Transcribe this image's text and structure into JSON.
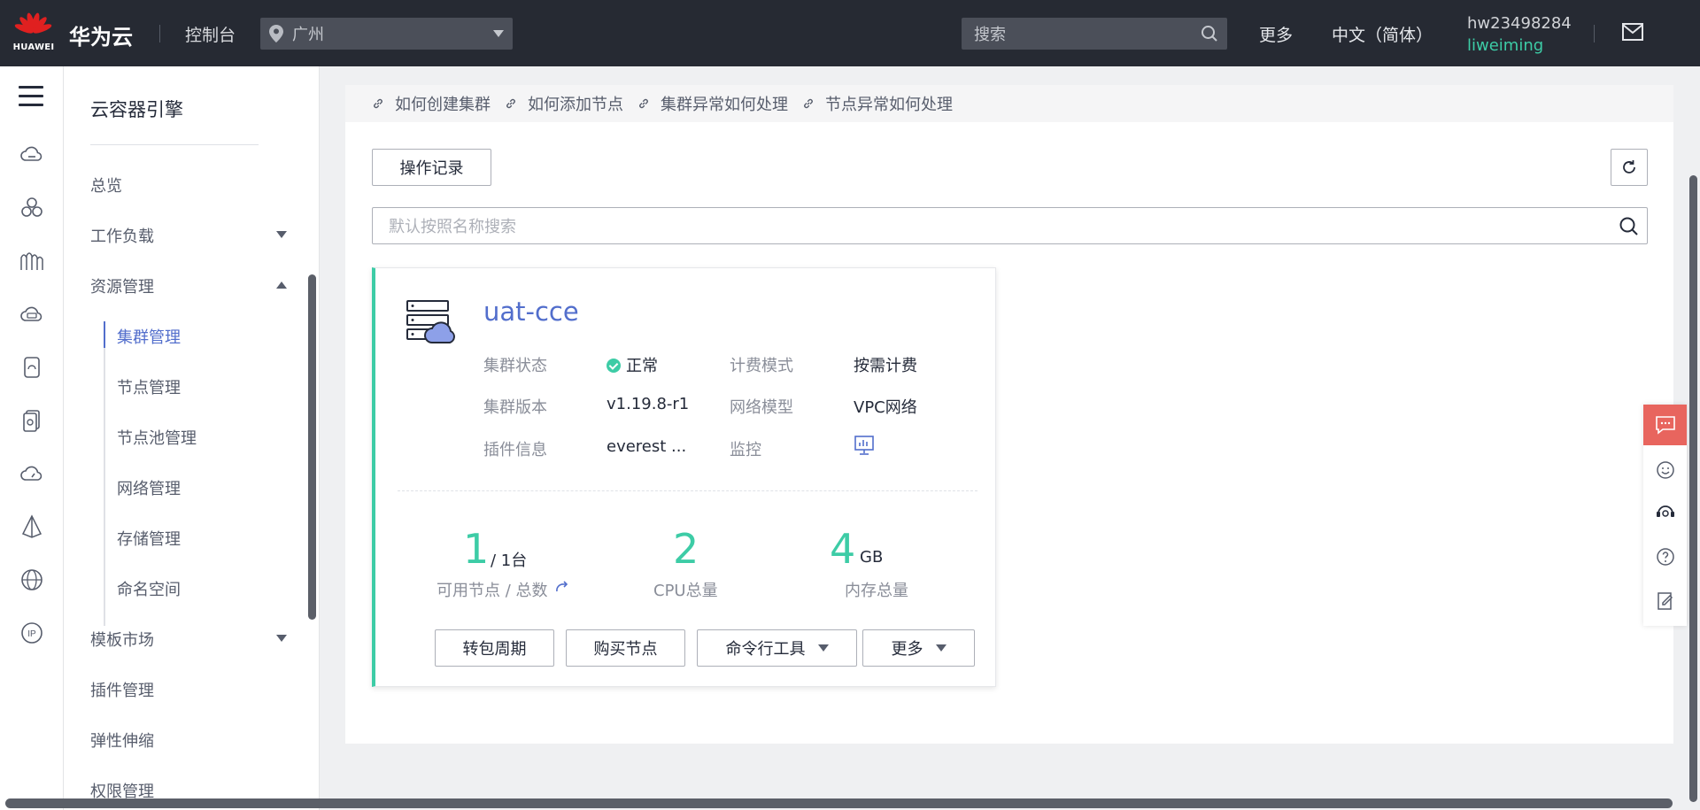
{
  "topbar": {
    "logo_text": "HUAWEI",
    "brand": "华为云",
    "console": "控制台",
    "region": "广州",
    "search_placeholder": "搜索",
    "more": "更多",
    "language": "中文（简体）",
    "account": "hw23498284",
    "username": "liweiming"
  },
  "menu": {
    "title": "云容器引擎",
    "items": {
      "overview": "总览",
      "workload": "工作负载",
      "resource": "资源管理",
      "cluster": "集群管理",
      "node": "节点管理",
      "nodepool": "节点池管理",
      "network": "网络管理",
      "storage": "存储管理",
      "namespace": "命名空间",
      "template": "模板市场",
      "addon": "插件管理",
      "autoscaling": "弹性伸缩",
      "permission": "权限管理"
    }
  },
  "help_links": [
    "如何创建集群",
    "如何添加节点",
    "集群异常如何处理",
    "节点异常如何处理"
  ],
  "toolbar": {
    "op_record": "操作记录",
    "search_placeholder": "默认按照名称搜索"
  },
  "cluster": {
    "name": "uat-cce",
    "status_label": "集群状态",
    "status_value": "正常",
    "billing_label": "计费模式",
    "billing_value": "按需计费",
    "version_label": "集群版本",
    "version_value": "v1.19.8-r1",
    "network_label": "网络模型",
    "network_value": "VPC网络",
    "addon_label": "插件信息",
    "addon_value": "everest ...",
    "monitor_label": "监控",
    "nodes_available": "1",
    "nodes_total": "/ 1台",
    "nodes_caption": "可用节点 / 总数",
    "cpu_total": "2",
    "cpu_caption": "CPU总量",
    "mem_total": "4",
    "mem_unit": "GB",
    "mem_caption": "内存总量",
    "buttons": {
      "renew": "转包周期",
      "buy_node": "购买节点",
      "kubectl": "命令行工具",
      "more": "更多"
    }
  },
  "colors": {
    "topbar": "#262a33",
    "accent": "#526ecc",
    "success": "#3dcca6",
    "chat": "#e8655e"
  }
}
